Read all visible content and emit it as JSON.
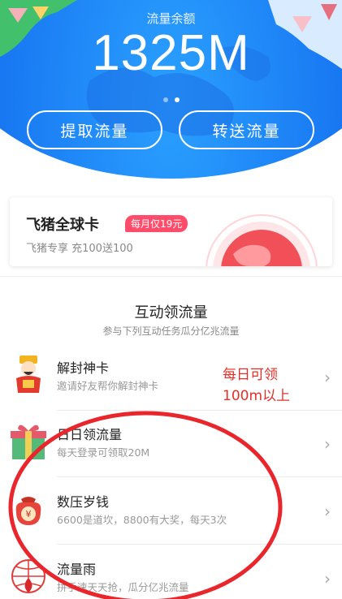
{
  "hero": {
    "title": "流量余额",
    "amount": "1325M",
    "buttons": {
      "extract": "提取流量",
      "transfer": "转送流量"
    },
    "carousel_active_index": 1,
    "bg_color": "#1877f2"
  },
  "card": {
    "title": "飞猪全球卡",
    "badge": "每月仅19元",
    "subtitle": "飞猪专享 充100送100",
    "badge_color": "#ff4c6a"
  },
  "section": {
    "title": "互动领流量",
    "subtitle": "参与下列互动任务瓜分亿兆流量"
  },
  "tasks": [
    {
      "title": "解封神卡",
      "desc": "邀请好友帮你解封神卡",
      "icon": "god-of-wealth-icon"
    },
    {
      "title": "日日领流量",
      "desc": "每天登录可领取20M",
      "icon": "gift-box-icon"
    },
    {
      "title": "数压岁钱",
      "desc": "6600是道坎，8800有大奖，每天3次",
      "icon": "money-bag-icon"
    },
    {
      "title": "流量雨",
      "desc": "拼手速天天抢，瓜分亿兆流量",
      "icon": "globe-rain-icon"
    }
  ],
  "annotation": {
    "line1": "每日可领",
    "line2": "100m以上",
    "color": "#e53027"
  }
}
